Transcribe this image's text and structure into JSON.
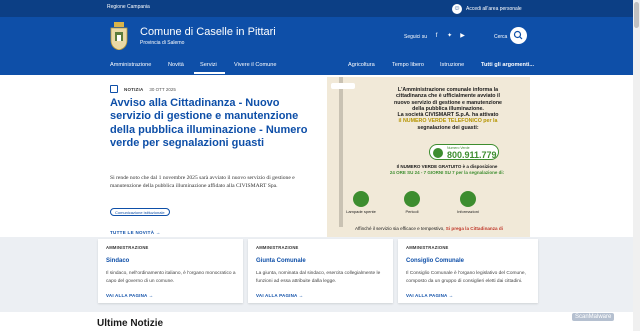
{
  "slim_header": {
    "region": "Regione Campania",
    "login_label": "Accedi all'area personale"
  },
  "header": {
    "title": "Comune di Caselle in Pittari",
    "subtitle": "Provincia di Salerno",
    "follow_label": "Seguici su",
    "social_icons": [
      "facebook-icon",
      "twitter-icon",
      "youtube-icon"
    ],
    "search_label": "Cerca",
    "brand_color": "#0e4fa8",
    "slim_color": "#0c3f85"
  },
  "nav": {
    "items": [
      "Amministrazione",
      "Novità",
      "Servizi",
      "Vivere il Comune"
    ],
    "active": "Servizi",
    "right_items": [
      "Agricoltura",
      "Tempo libero",
      "Istruzione"
    ],
    "all_topics": "Tutti gli argomenti..."
  },
  "hero": {
    "category": "NOTIZIA",
    "date": "30 OTT 2025",
    "title": "Avviso alla Cittadinanza - Nuovo servizio di gestione e manutenzione della pubblica illuminazione - Numero verde per segnalazioni guasti",
    "description": "Si rende noto che dal 1 novembre 2025 sarà avviato il nuovo servizio di gestione e manutenzione della pubblica illuminazione affidato alla CIVISMART Spa.",
    "tag": "Comunicazione istituzionale",
    "all_news": "TUTTE LE NOVITÀ"
  },
  "poster": {
    "line1": "L'Amministrazione comunale informa la",
    "line2": "cittadinanza che è ufficialmente avviato il",
    "line3": "nuovo servizio di gestione e manutenzione",
    "line4": "della pubblica illuminazione.",
    "line5": "La società CIVISMART S.p.A. ha attivato",
    "line6": "il NUMERO VERDE TELEFONICO per la",
    "line7": "segnalazione dei guasti:",
    "pill_label": "Numero Verde",
    "phone": "800.911.779",
    "free_line1": "Il NUMERO VERDE GRATUITO è a disposizione",
    "free_line2": "24 ORE SU 24 - 7 GIORNI SU 7 per la segnalazione di:",
    "icons": [
      {
        "label": "Lampade spente",
        "icon": "lamp-icon",
        "color": "#3d8d2f"
      },
      {
        "label": "Pericoli",
        "icon": "warning-icon",
        "color": "#3d8d2f"
      },
      {
        "label": "Informazioni",
        "icon": "headset-icon",
        "color": "#3d8d2f"
      }
    ],
    "footer": "Affinché il servizio sia efficace e tempestivo,",
    "footer_red": "Si prega la Cittadinanza di"
  },
  "cards": [
    {
      "kicker": "AMMINISTRAZIONE",
      "title": "Sindaco",
      "text": "Il sindaco, nell'ordinamento italiano, è l'organo monocratico a capo del governo di un comune.",
      "link": "VAI ALLA PAGINA"
    },
    {
      "kicker": "AMMINISTRAZIONE",
      "title": "Giunta Comunale",
      "text": "La giunta, nominata dal sindaco, esercita collegialmente le funzioni ad essa attribuite dalla legge.",
      "link": "VAI ALLA PAGINA"
    },
    {
      "kicker": "AMMINISTRAZIONE",
      "title": "Consiglio Comunale",
      "text": "Il Consiglio Comunale è l'organo legislativo del Comune, composto da un gruppo di consiglieri eletti dai cittadini.",
      "link": "VAI ALLA PAGINA"
    }
  ],
  "latest_news_heading": "Ultime Notizie",
  "watermark": "ScanMalware"
}
